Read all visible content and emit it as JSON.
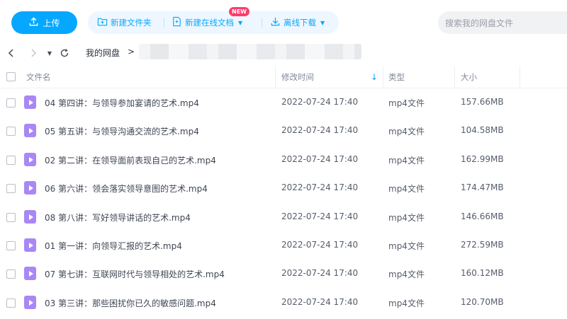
{
  "toolbar": {
    "upload_label": "上传",
    "new_folder_label": "新建文件夹",
    "new_online_doc_label": "新建在线文档",
    "new_badge": "NEW",
    "offline_download_label": "离线下载",
    "search_placeholder": "搜索我的网盘文件"
  },
  "breadcrumb": {
    "root": "我的网盘",
    "separator": ">"
  },
  "table": {
    "headers": {
      "name": "文件名",
      "modified": "修改时间",
      "type": "类型",
      "size": "大小"
    },
    "sort": {
      "column": "modified",
      "direction": "descending"
    },
    "rows": [
      {
        "name": "04 第四讲：与领导参加宴请的艺术.mp4",
        "modified": "2022-07-24 17:40",
        "type": "mp4文件",
        "size": "157.66MB"
      },
      {
        "name": "05 第五讲：与领导沟通交流的艺术.mp4",
        "modified": "2022-07-24 17:40",
        "type": "mp4文件",
        "size": "104.58MB"
      },
      {
        "name": "02 第二讲：在领导面前表现自己的艺术.mp4",
        "modified": "2022-07-24 17:40",
        "type": "mp4文件",
        "size": "162.99MB"
      },
      {
        "name": "06 第六讲：领会落实领导意图的艺术.mp4",
        "modified": "2022-07-24 17:40",
        "type": "mp4文件",
        "size": "174.47MB"
      },
      {
        "name": "08 第八讲：写好领导讲话的艺术.mp4",
        "modified": "2022-07-24 17:40",
        "type": "mp4文件",
        "size": "146.66MB"
      },
      {
        "name": "01 第一讲：向领导汇报的艺术.mp4",
        "modified": "2022-07-24 17:40",
        "type": "mp4文件",
        "size": "272.59MB"
      },
      {
        "name": "07 第七讲：互联网时代与领导相处的艺术.mp4",
        "modified": "2022-07-24 17:40",
        "type": "mp4文件",
        "size": "160.12MB"
      },
      {
        "name": "03 第三讲：那些困扰你已久的敏感问题.mp4",
        "modified": "2022-07-24 17:40",
        "type": "mp4文件",
        "size": "120.70MB"
      }
    ]
  },
  "colors": {
    "accent": "#06a7ff",
    "file_icon": "#a987f5",
    "badge": "#ff3b6b"
  },
  "icons": {
    "upload": "upload-icon",
    "new_folder": "folder-plus-icon",
    "new_doc": "doc-plus-icon",
    "offline_download": "download-icon",
    "back": "chevron-left-icon",
    "forward": "chevron-right-icon",
    "history": "caret-down-icon",
    "refresh": "refresh-icon",
    "video_file": "video-file-icon"
  }
}
